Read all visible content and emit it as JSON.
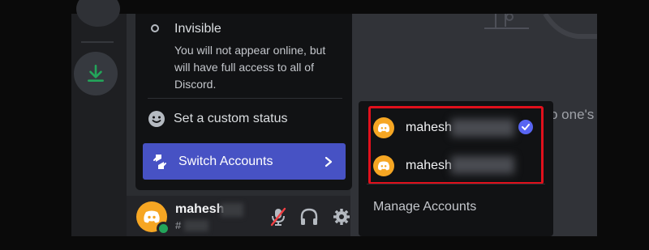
{
  "status_menu": {
    "invisible": {
      "label": "Invisible",
      "description": "You will not appear online, but will have full access to all of Discord."
    },
    "custom_status_label": "Set a custom status",
    "switch_accounts_label": "Switch Accounts"
  },
  "user_panel": {
    "username": "mahesh",
    "tag_prefix": "#",
    "status": "online"
  },
  "account_switcher": {
    "accounts": [
      {
        "name": "mahesh",
        "active": true
      },
      {
        "name": "mahesh",
        "active": false
      }
    ],
    "manage_label": "Manage Accounts"
  },
  "chat": {
    "partial_text": "o one's"
  },
  "colors": {
    "blurple": "#5865f2",
    "switch_highlight": "#4752c4",
    "avatar_orange": "#f6a623",
    "online_green": "#23a55a",
    "download_green": "#23a55a",
    "highlight_red": "#e0101c",
    "mute_red": "#f23f43"
  },
  "icons": [
    "download-icon",
    "smiley-icon",
    "switch-accounts-icon",
    "chevron-right-icon",
    "discord-logo-icon",
    "muted-mic-icon",
    "headphones-icon",
    "gear-icon",
    "checkmark-icon"
  ]
}
